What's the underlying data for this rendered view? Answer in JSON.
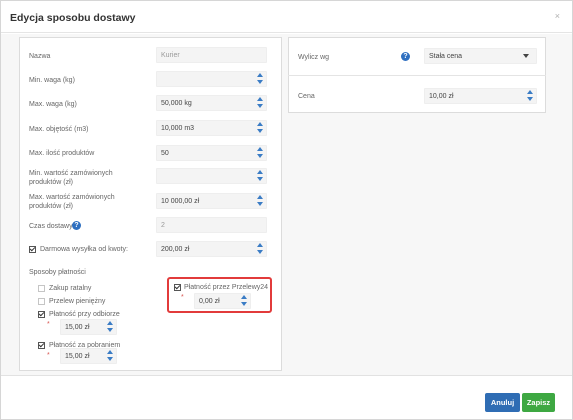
{
  "dialog": {
    "title": "Edycja sposobu dostawy",
    "close_symbol": "×"
  },
  "form": {
    "name_label": "Nazwa",
    "name_value": "Kurier",
    "min_weight_label": "Min. waga (kg)",
    "min_weight_value": "",
    "max_weight_label": "Max. waga (kg)",
    "max_weight_value": "50,000 kg",
    "max_volume_label": "Max. objętość (m3)",
    "max_volume_value": "10,000 m3",
    "max_products_label": "Max. ilość produktów",
    "max_products_value": "50",
    "min_order_label_1": "Min. wartość zamówionych",
    "min_order_label_2": "produktów (zł)",
    "min_order_value": "",
    "max_order_label_1": "Max. wartość zamówionych",
    "max_order_label_2": "produktów (zł)",
    "max_order_value": "10 000,00 zł",
    "delivery_time_label": "Czas dostawy",
    "delivery_time_value": "2",
    "free_shipping_label": "Darmowa wysyłka od kwoty:",
    "free_shipping_checked": true,
    "free_shipping_value": "200,00 zł"
  },
  "payments": {
    "section_label": "Sposoby płatności",
    "items": [
      {
        "label": "Zakup ratalny",
        "checked": false
      },
      {
        "label": "Przelew pieniężny",
        "checked": false
      },
      {
        "label": "Płatność przy odbiorze",
        "checked": true,
        "value": "15,00 zł"
      },
      {
        "label": "Płatność za pobraniem",
        "checked": true,
        "value": "15,00 zł"
      }
    ],
    "przelewy24": {
      "label": "Płatność przez Przelewy24",
      "checked": true,
      "value": "0,00 zł"
    },
    "required_marker": "*"
  },
  "right": {
    "calc_label": "Wylicz wg",
    "calc_value": "Stała cena",
    "price_label": "Cena",
    "price_value": "10,00 zł"
  },
  "footer": {
    "cancel_label": "Anuluj",
    "save_label": "Zapisz"
  },
  "colors": {
    "accent_blue": "#2f6db4",
    "save_green": "#3ea842",
    "highlight_red": "#e23b3b"
  }
}
